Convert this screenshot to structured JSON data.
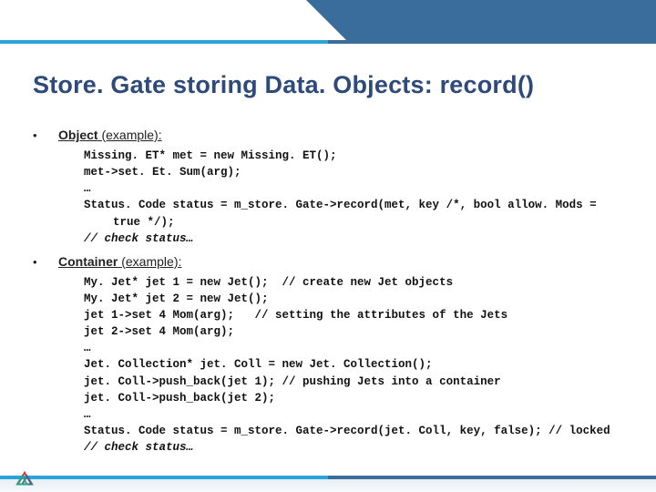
{
  "title": "Store. Gate storing Data. Objects:   record()",
  "sections": [
    {
      "heading_bold": "Object",
      "heading_rest": " (example):",
      "code": [
        {
          "t": "Missing. ET* met = new Missing. ET();"
        },
        {
          "t": "met->set. Et. Sum(arg);"
        },
        {
          "t": "…"
        },
        {
          "t": "Status. Code status = m_store. Gate->record(met, key /*, bool allow. Mods ="
        },
        {
          "t": "true */);",
          "indent": true
        },
        {
          "t": "// check status…",
          "comment": true
        }
      ]
    },
    {
      "heading_bold": "Container",
      "heading_rest": " (example):",
      "code": [
        {
          "t": "My. Jet* jet 1 = new Jet();  // create new Jet objects"
        },
        {
          "t": "My. Jet* jet 2 = new Jet();"
        },
        {
          "t": "jet 1->set 4 Mom(arg);   // setting the attributes of the Jets"
        },
        {
          "t": "jet 2->set 4 Mom(arg);"
        },
        {
          "t": "…"
        },
        {
          "t": "Jet. Collection* jet. Coll = new Jet. Collection();"
        },
        {
          "t": "jet. Coll->push_back(jet 1); // pushing Jets into a container"
        },
        {
          "t": "jet. Coll->push_back(jet 2);"
        },
        {
          "t": "…"
        },
        {
          "t": "Status. Code status = m_store. Gate->record(jet. Coll, key, false); // locked"
        },
        {
          "t": "// check status…",
          "comment": true
        }
      ]
    }
  ]
}
